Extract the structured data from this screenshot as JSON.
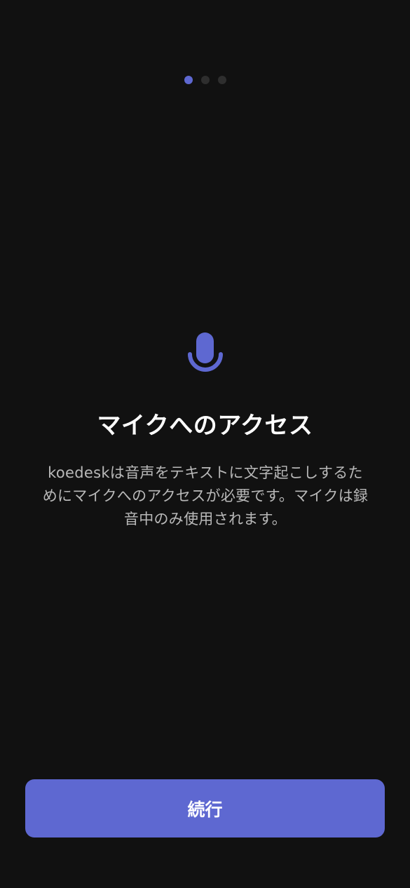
{
  "pagination": {
    "total": 3,
    "current": 1
  },
  "permission": {
    "icon": "microphone-icon",
    "title": "マイクへのアクセス",
    "description": "koedeskは音声をテキストに文字起こしするためにマイクへのアクセスが必要です。マイクは録音中のみ使用されます。"
  },
  "actions": {
    "continue_label": "続行"
  },
  "colors": {
    "background": "#111111",
    "accent": "#5e68d1",
    "inactive_dot": "#2e2e2e",
    "title": "#ffffff",
    "body_text": "#b9b9b9"
  }
}
